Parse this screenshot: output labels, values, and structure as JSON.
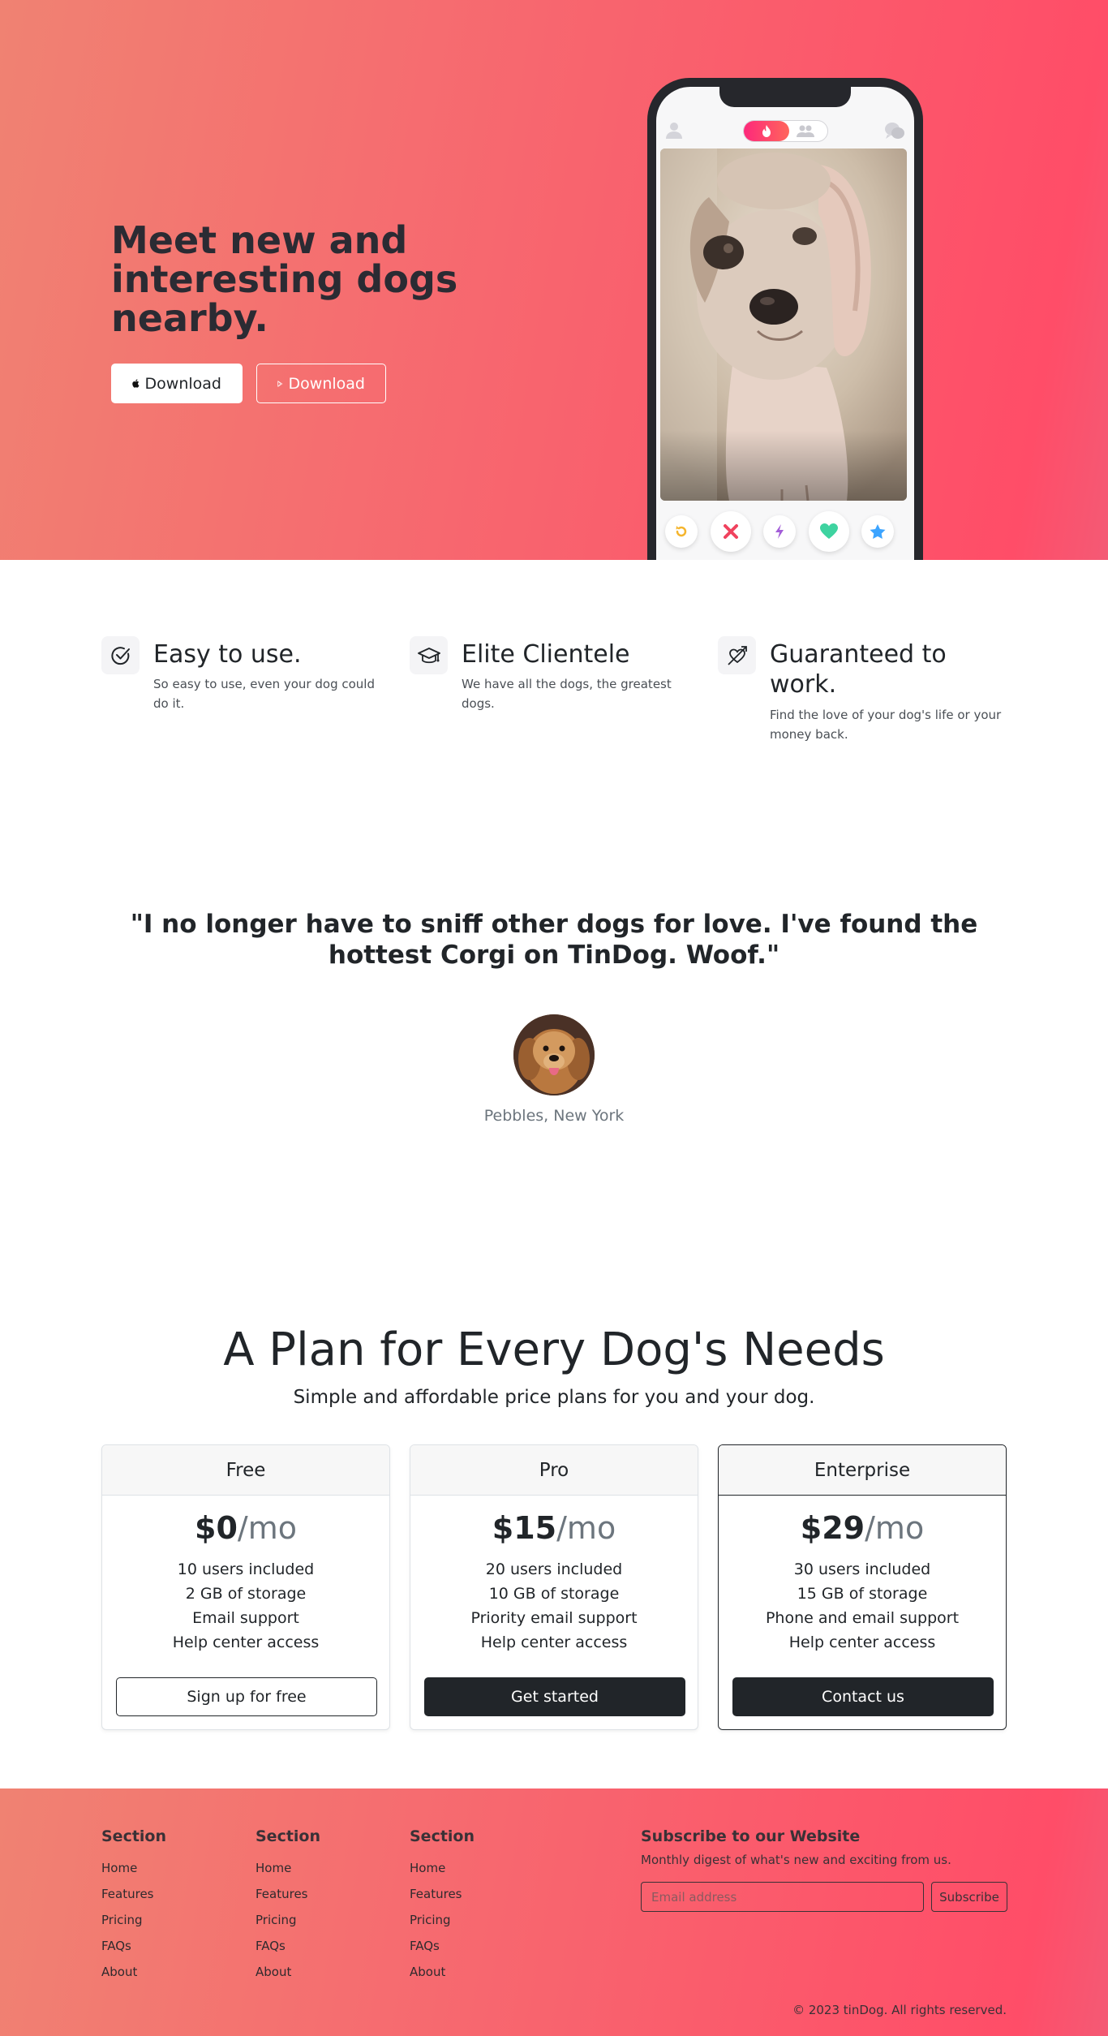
{
  "hero": {
    "title": "Meet new and interesting dogs nearby.",
    "download_apple_label": "Download",
    "download_play_label": "Download"
  },
  "features": [
    {
      "title": "Easy to use.",
      "text": "So easy to use, even your dog could do it.",
      "icon": "check-circle-icon"
    },
    {
      "title": "Elite Clientele",
      "text": "We have all the dogs, the greatest dogs.",
      "icon": "graduation-cap-icon"
    },
    {
      "title": "Guaranteed to work.",
      "text": "Find the love of your dog's life or your money back.",
      "icon": "heart-arrow-icon"
    }
  ],
  "testimonial": {
    "quote": "\"I no longer have to sniff other dogs for love. I've found the hottest Corgi on TinDog. Woof.\"",
    "author": "Pebbles, New York"
  },
  "pricing": {
    "title": "A Plan for Every Dog's Needs",
    "subtitle": "Simple and affordable price plans for you and your dog.",
    "plans": [
      {
        "name": "Free",
        "price": "$0",
        "per": "/mo",
        "features": [
          "10 users included",
          "2 GB of storage",
          "Email support",
          "Help center access"
        ],
        "button": "Sign up for free"
      },
      {
        "name": "Pro",
        "price": "$15",
        "per": "/mo",
        "features": [
          "20 users included",
          "10 GB of storage",
          "Priority email support",
          "Help center access"
        ],
        "button": "Get started"
      },
      {
        "name": "Enterprise",
        "price": "$29",
        "per": "/mo",
        "features": [
          "30 users included",
          "15 GB of storage",
          "Phone and email support",
          "Help center access"
        ],
        "button": "Contact us"
      }
    ]
  },
  "footer": {
    "columns": [
      {
        "title": "Section",
        "links": [
          "Home",
          "Features",
          "Pricing",
          "FAQs",
          "About"
        ]
      },
      {
        "title": "Section",
        "links": [
          "Home",
          "Features",
          "Pricing",
          "FAQs",
          "About"
        ]
      },
      {
        "title": "Section",
        "links": [
          "Home",
          "Features",
          "Pricing",
          "FAQs",
          "About"
        ]
      }
    ],
    "subscribe_title": "Subscribe to our Website",
    "subscribe_text": "Monthly digest of what's new and exciting from us.",
    "email_placeholder": "Email address",
    "subscribe_button": "Subscribe",
    "copyright": "© 2023 tinDog. All rights reserved."
  },
  "colors": {
    "gradient_start": "#f08272",
    "gradient_end": "#ff4d68",
    "dark": "#212529"
  }
}
